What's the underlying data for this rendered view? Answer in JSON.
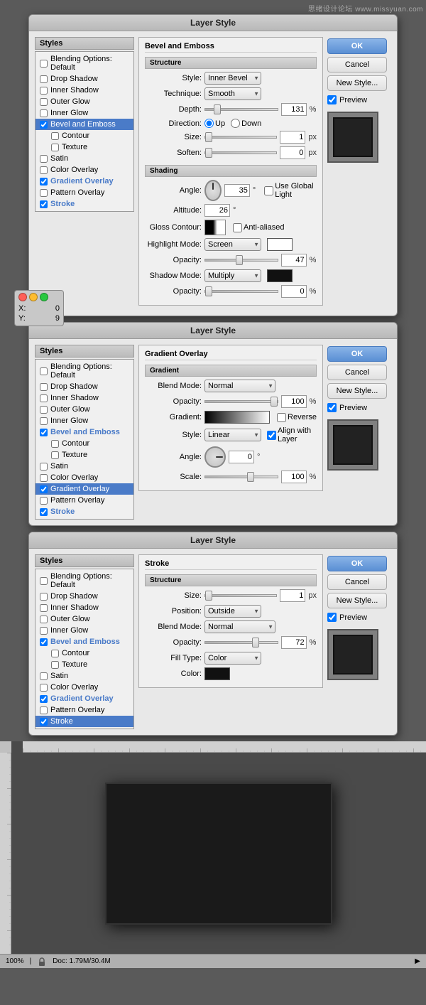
{
  "watermark": "思绪设计论坛 www.missyuan.com",
  "dialog1": {
    "title": "Layer Style",
    "section_bevel": "Bevel and Emboss",
    "sub_structure": "Structure",
    "style_label": "Style:",
    "style_value": "Inner Bevel",
    "technique_label": "Technique:",
    "technique_value": "Smooth",
    "depth_label": "Depth:",
    "depth_value": "131",
    "depth_unit": "%",
    "direction_label": "Direction:",
    "direction_up": "Up",
    "direction_down": "Down",
    "size_label": "Size:",
    "size_value": "1",
    "size_unit": "px",
    "soften_label": "Soften:",
    "soften_value": "0",
    "soften_unit": "px",
    "sub_shading": "Shading",
    "angle_label": "Angle:",
    "angle_value": "35",
    "angle_unit": "°",
    "use_global_light": "Use Global Light",
    "altitude_label": "Altitude:",
    "altitude_value": "26",
    "altitude_unit": "°",
    "gloss_contour_label": "Gloss Contour:",
    "anti_aliased": "Anti-aliased",
    "highlight_mode_label": "Highlight Mode:",
    "highlight_mode_value": "Screen",
    "highlight_opacity_label": "Opacity:",
    "highlight_opacity_value": "47",
    "highlight_opacity_unit": "%",
    "shadow_mode_label": "Shadow Mode:",
    "shadow_mode_value": "Multiply",
    "shadow_opacity_label": "Opacity:",
    "shadow_opacity_value": "0",
    "shadow_opacity_unit": "%",
    "btn_ok": "OK",
    "btn_cancel": "Cancel",
    "btn_new_style": "New Style...",
    "preview_label": "Preview"
  },
  "dialog2": {
    "title": "Layer Style",
    "section_gradient": "Gradient Overlay",
    "sub_gradient": "Gradient",
    "blend_mode_label": "Blend Mode:",
    "blend_mode_value": "Normal",
    "opacity_label": "Opacity:",
    "opacity_value": "100",
    "opacity_unit": "%",
    "gradient_label": "Gradient:",
    "reverse_label": "Reverse",
    "style_label": "Style:",
    "style_value": "Linear",
    "align_with_layer": "Align with Layer",
    "angle_label": "Angle:",
    "angle_value": "0",
    "angle_unit": "°",
    "scale_label": "Scale:",
    "scale_value": "100",
    "scale_unit": "%",
    "btn_ok": "OK",
    "btn_cancel": "Cancel",
    "btn_new_style": "New Style...",
    "preview_label": "Preview"
  },
  "dialog3": {
    "title": "Layer Style",
    "section_stroke": "Stroke",
    "sub_structure": "Structure",
    "size_label": "Size:",
    "size_value": "1",
    "size_unit": "px",
    "position_label": "Position:",
    "position_value": "Outside",
    "blend_mode_label": "Blend Mode:",
    "blend_mode_value": "Normal",
    "opacity_label": "Opacity:",
    "opacity_value": "72",
    "opacity_unit": "%",
    "fill_type_label": "Fill Type:",
    "fill_type_value": "Color",
    "color_label": "Color:",
    "btn_ok": "OK",
    "btn_cancel": "Cancel",
    "btn_new_style": "New Style...",
    "preview_label": "Preview"
  },
  "styles_list": {
    "title": "Styles",
    "items": [
      {
        "label": "Blending Options: Default",
        "checked": false,
        "active": false,
        "sub": false
      },
      {
        "label": "Drop Shadow",
        "checked": false,
        "active": false,
        "sub": false
      },
      {
        "label": "Inner Shadow",
        "checked": false,
        "active": false,
        "sub": false
      },
      {
        "label": "Outer Glow",
        "checked": false,
        "active": false,
        "sub": false
      },
      {
        "label": "Inner Glow",
        "checked": false,
        "active": false,
        "sub": false
      },
      {
        "label": "Bevel and Emboss",
        "checked": true,
        "active": true,
        "sub": false
      },
      {
        "label": "Contour",
        "checked": false,
        "active": false,
        "sub": true
      },
      {
        "label": "Texture",
        "checked": false,
        "active": false,
        "sub": true
      },
      {
        "label": "Satin",
        "checked": false,
        "active": false,
        "sub": false
      },
      {
        "label": "Color Overlay",
        "checked": false,
        "active": false,
        "sub": false
      },
      {
        "label": "Gradient Overlay",
        "checked": true,
        "active": false,
        "sub": false
      },
      {
        "label": "Pattern Overlay",
        "checked": false,
        "active": false,
        "sub": false
      },
      {
        "label": "Stroke",
        "checked": true,
        "active": false,
        "sub": false
      }
    ]
  },
  "styles_list2": {
    "title": "Styles",
    "items": [
      {
        "label": "Blending Options: Default",
        "checked": false,
        "active": false,
        "sub": false
      },
      {
        "label": "Drop Shadow",
        "checked": false,
        "active": false,
        "sub": false
      },
      {
        "label": "Inner Shadow",
        "checked": false,
        "active": false,
        "sub": false
      },
      {
        "label": "Outer Glow",
        "checked": false,
        "active": false,
        "sub": false
      },
      {
        "label": "Inner Glow",
        "checked": false,
        "active": false,
        "sub": false
      },
      {
        "label": "Bevel and Emboss",
        "checked": true,
        "active": false,
        "sub": false
      },
      {
        "label": "Contour",
        "checked": false,
        "active": false,
        "sub": true
      },
      {
        "label": "Texture",
        "checked": false,
        "active": false,
        "sub": true
      },
      {
        "label": "Satin",
        "checked": false,
        "active": false,
        "sub": false
      },
      {
        "label": "Color Overlay",
        "checked": false,
        "active": false,
        "sub": false
      },
      {
        "label": "Gradient Overlay",
        "checked": true,
        "active": true,
        "sub": false
      },
      {
        "label": "Pattern Overlay",
        "checked": false,
        "active": false,
        "sub": false
      },
      {
        "label": "Stroke",
        "checked": true,
        "active": false,
        "sub": false
      }
    ]
  },
  "styles_list3": {
    "title": "Styles",
    "items": [
      {
        "label": "Blending Options: Default",
        "checked": false,
        "active": false,
        "sub": false
      },
      {
        "label": "Drop Shadow",
        "checked": false,
        "active": false,
        "sub": false
      },
      {
        "label": "Inner Shadow",
        "checked": false,
        "active": false,
        "sub": false
      },
      {
        "label": "Outer Glow",
        "checked": false,
        "active": false,
        "sub": false
      },
      {
        "label": "Inner Glow",
        "checked": false,
        "active": false,
        "sub": false
      },
      {
        "label": "Bevel and Emboss",
        "checked": true,
        "active": false,
        "sub": false
      },
      {
        "label": "Contour",
        "checked": false,
        "active": false,
        "sub": true
      },
      {
        "label": "Texture",
        "checked": false,
        "active": false,
        "sub": true
      },
      {
        "label": "Satin",
        "checked": false,
        "active": false,
        "sub": false
      },
      {
        "label": "Color Overlay",
        "checked": false,
        "active": false,
        "sub": false
      },
      {
        "label": "Gradient Overlay",
        "checked": true,
        "active": false,
        "sub": false
      },
      {
        "label": "Pattern Overlay",
        "checked": false,
        "active": false,
        "sub": false
      },
      {
        "label": "Stroke",
        "checked": true,
        "active": true,
        "sub": false
      }
    ]
  },
  "status_bar": {
    "zoom": "100%",
    "doc_info": "Doc: 1.79M/30.4M"
  },
  "pos_window": {
    "x_label": "X:",
    "x_value": "0",
    "y_label": "Y:",
    "y_value": "9"
  }
}
